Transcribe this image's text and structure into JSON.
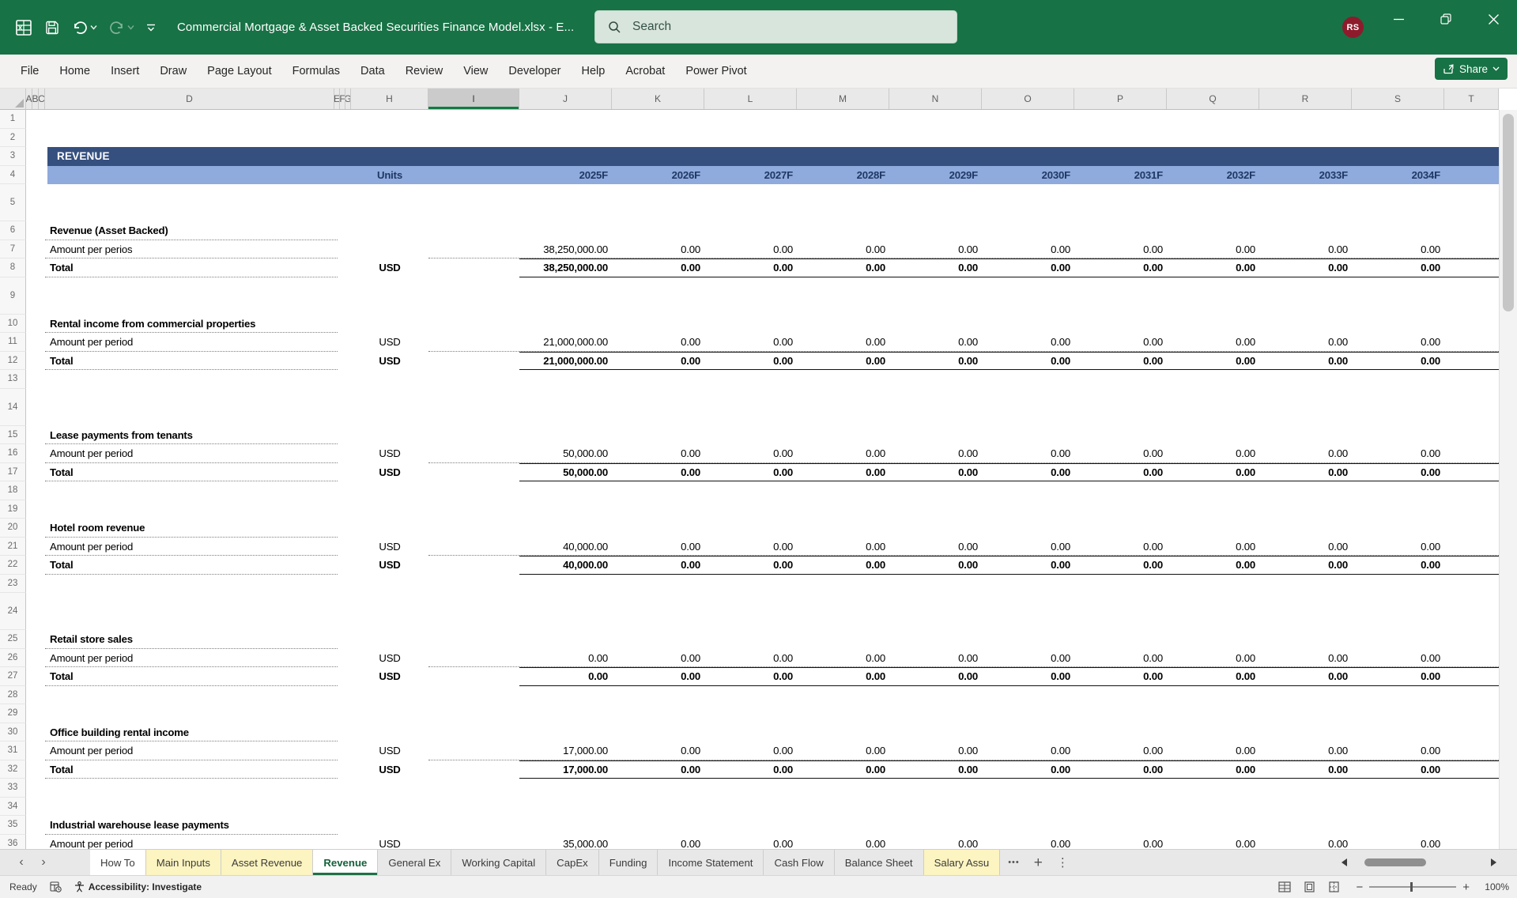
{
  "window": {
    "title": "Commercial Mortgage & Asset Backed Securities Finance Model.xlsx - E...",
    "search_placeholder": "Search",
    "avatar_initials": "RS"
  },
  "menu_bar": {
    "tabs": [
      "File",
      "Home",
      "Insert",
      "Draw",
      "Page Layout",
      "Formulas",
      "Data",
      "Review",
      "View",
      "Developer",
      "Help",
      "Acrobat",
      "Power Pivot"
    ],
    "share_label": "Share"
  },
  "column_headers": {
    "letters": [
      "A",
      "B",
      "C",
      "D",
      "E",
      "F",
      "G",
      "H",
      "I",
      "J",
      "K",
      "L",
      "M",
      "N",
      "O",
      "P",
      "Q",
      "R",
      "S",
      "T"
    ],
    "selected": "I"
  },
  "grid": {
    "first_row": 1,
    "last_row": 36,
    "banner": "REVENUE",
    "units_header": "Units",
    "years": [
      "2025F",
      "2026F",
      "2027F",
      "2028F",
      "2029F",
      "2030F",
      "2031F",
      "2032F",
      "2033F",
      "2034F"
    ],
    "sections": [
      {
        "title": "Revenue (Asset Backed)",
        "amount": {
          "label": "Amount per perios",
          "units": "",
          "values": [
            "38,250,000.00",
            "0.00",
            "0.00",
            "0.00",
            "0.00",
            "0.00",
            "0.00",
            "0.00",
            "0.00",
            "0.00"
          ]
        },
        "total": {
          "label": "Total",
          "units": "USD",
          "values": [
            "38,250,000.00",
            "0.00",
            "0.00",
            "0.00",
            "0.00",
            "0.00",
            "0.00",
            "0.00",
            "0.00",
            "0.00"
          ]
        }
      },
      {
        "title": "Rental income from commercial properties",
        "amount": {
          "label": "Amount per period",
          "units": "USD",
          "values": [
            "21,000,000.00",
            "0.00",
            "0.00",
            "0.00",
            "0.00",
            "0.00",
            "0.00",
            "0.00",
            "0.00",
            "0.00"
          ]
        },
        "total": {
          "label": "Total",
          "units": "USD",
          "values": [
            "21,000,000.00",
            "0.00",
            "0.00",
            "0.00",
            "0.00",
            "0.00",
            "0.00",
            "0.00",
            "0.00",
            "0.00"
          ]
        }
      },
      {
        "title": "Lease payments from tenants",
        "amount": {
          "label": "Amount per period",
          "units": "USD",
          "values": [
            "50,000.00",
            "0.00",
            "0.00",
            "0.00",
            "0.00",
            "0.00",
            "0.00",
            "0.00",
            "0.00",
            "0.00"
          ]
        },
        "total": {
          "label": "Total",
          "units": "USD",
          "values": [
            "50,000.00",
            "0.00",
            "0.00",
            "0.00",
            "0.00",
            "0.00",
            "0.00",
            "0.00",
            "0.00",
            "0.00"
          ]
        }
      },
      {
        "title": "Hotel room revenue",
        "amount": {
          "label": "Amount per period",
          "units": "USD",
          "values": [
            "40,000.00",
            "0.00",
            "0.00",
            "0.00",
            "0.00",
            "0.00",
            "0.00",
            "0.00",
            "0.00",
            "0.00"
          ]
        },
        "total": {
          "label": "Total",
          "units": "USD",
          "values": [
            "40,000.00",
            "0.00",
            "0.00",
            "0.00",
            "0.00",
            "0.00",
            "0.00",
            "0.00",
            "0.00",
            "0.00"
          ]
        }
      },
      {
        "title": "Retail store sales",
        "amount": {
          "label": "Amount per period",
          "units": "USD",
          "values": [
            "0.00",
            "0.00",
            "0.00",
            "0.00",
            "0.00",
            "0.00",
            "0.00",
            "0.00",
            "0.00",
            "0.00"
          ]
        },
        "total": {
          "label": "Total",
          "units": "USD",
          "values": [
            "0.00",
            "0.00",
            "0.00",
            "0.00",
            "0.00",
            "0.00",
            "0.00",
            "0.00",
            "0.00",
            "0.00"
          ]
        }
      },
      {
        "title": "Office building rental income",
        "amount": {
          "label": "Amount per period",
          "units": "USD",
          "values": [
            "17,000.00",
            "0.00",
            "0.00",
            "0.00",
            "0.00",
            "0.00",
            "0.00",
            "0.00",
            "0.00",
            "0.00"
          ]
        },
        "total": {
          "label": "Total",
          "units": "USD",
          "values": [
            "17,000.00",
            "0.00",
            "0.00",
            "0.00",
            "0.00",
            "0.00",
            "0.00",
            "0.00",
            "0.00",
            "0.00"
          ]
        }
      },
      {
        "title": "Industrial warehouse lease payments",
        "amount": {
          "label": "Amount per period",
          "units": "USD",
          "values": [
            "35,000.00",
            "0.00",
            "0.00",
            "0.00",
            "0.00",
            "0.00",
            "0.00",
            "0.00",
            "0.00",
            "0.00"
          ]
        },
        "total": null
      }
    ]
  },
  "sheet_tabs": {
    "tabs": [
      {
        "label": "How To",
        "color": "white",
        "active": false
      },
      {
        "label": "Main Inputs",
        "color": "yellow",
        "active": false
      },
      {
        "label": "Asset Revenue",
        "color": "yellow",
        "active": false
      },
      {
        "label": "Revenue",
        "color": "white",
        "active": true
      },
      {
        "label": "General Ex",
        "color": "default",
        "active": false
      },
      {
        "label": "Working Capital",
        "color": "default",
        "active": false
      },
      {
        "label": "CapEx",
        "color": "default",
        "active": false
      },
      {
        "label": "Funding",
        "color": "default",
        "active": false
      },
      {
        "label": "Income Statement",
        "color": "default",
        "active": false
      },
      {
        "label": "Cash Flow",
        "color": "default",
        "active": false
      },
      {
        "label": "Balance Sheet",
        "color": "default",
        "active": false
      },
      {
        "label": "Salary Assu",
        "color": "yellow",
        "active": false
      }
    ],
    "glyphs": {
      "prev": "‹",
      "next": "›",
      "more": "•••",
      "add": "+",
      "menu": "⋮"
    }
  },
  "status_bar": {
    "mode": "Ready",
    "accessibility": "Accessibility: Investigate",
    "zoom_out": "−",
    "zoom_in": "+",
    "zoom_level": "100%"
  },
  "colors": {
    "accent_green": "#177245",
    "header_select_green": "#107C41",
    "banner_navy": "#35507F",
    "banner_light_blue": "#8FAADC",
    "navy_text": "#1F3864",
    "tab_yellow": "#FCF4C1",
    "avatar_red": "#8E1B2C"
  }
}
